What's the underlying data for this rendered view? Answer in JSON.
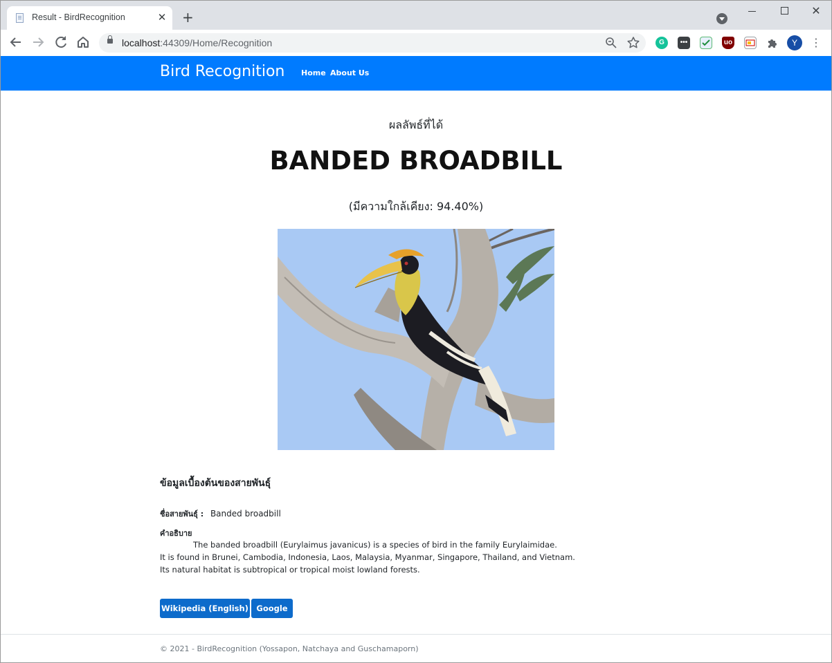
{
  "browser": {
    "tab_title": "Result - BirdRecognition",
    "tab_close": "✕",
    "new_tab": "+",
    "url_host": "localhost",
    "url_rest": ":44309/Home/Recognition",
    "window_close": "✕"
  },
  "navbar": {
    "brand": "Bird Recognition",
    "links": [
      "Home",
      "About Us"
    ],
    "color": "#007bff"
  },
  "result": {
    "label": "ผลลัพธ์ที่ได้",
    "species": "BANDED BROADBILL",
    "confidence_text": "(มีความใกล้เคียง: 94.40%)"
  },
  "info": {
    "heading": "ข้อมูลเบื้องต้นของสายพันธุ์",
    "name_label": "ชื่อสายพันธุ์ :",
    "name_value": "Banded broadbill",
    "description_label": "คำอธิบาย",
    "description_lines": [
      "The banded broadbill (Eurylaimus javanicus) is a species of bird in the family Eurylaimidae.",
      "It is found in Brunei, Cambodia, Indonesia, Laos, Malaysia, Myanmar, Singapore, Thailand, and Vietnam.",
      "Its natural habitat is subtropical or tropical moist lowland forests."
    ]
  },
  "buttons": {
    "wikipedia": "Wikipedia (English)",
    "google": "Google"
  },
  "footer": {
    "text": "© 2021 - BirdRecognition (Yossapon, Natchaya and Guschamaporn)"
  },
  "icons": [
    "back-icon",
    "forward-icon",
    "reload-icon",
    "home-icon",
    "lock-icon",
    "zoom-icon",
    "star-icon",
    "grammarly-icon",
    "extension-icon",
    "puzzle-icon",
    "menu-icon"
  ]
}
